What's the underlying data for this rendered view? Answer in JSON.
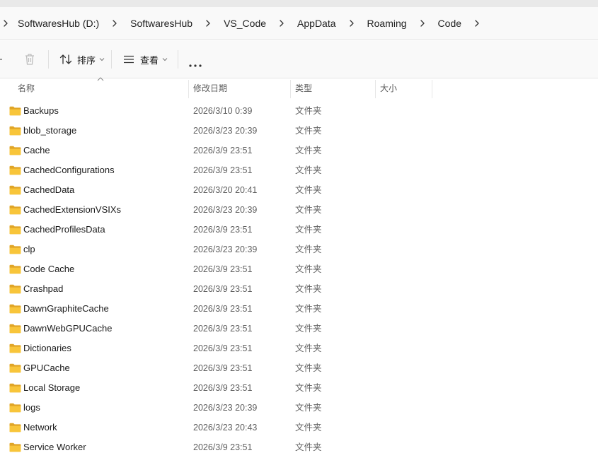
{
  "breadcrumb": [
    "SoftwaresHub (D:)",
    "SoftwaresHub",
    "VS_Code",
    "AppData",
    "Roaming",
    "Code"
  ],
  "toolbar": {
    "sort_label": "排序",
    "view_label": "查看",
    "more_label": "···"
  },
  "columns": {
    "name": "名称",
    "date": "修改日期",
    "type": "类型",
    "size": "大小"
  },
  "files": [
    {
      "name": "Backups",
      "date": "2026/3/10 0:39",
      "type": "文件夹",
      "size": ""
    },
    {
      "name": "blob_storage",
      "date": "2026/3/23 20:39",
      "type": "文件夹",
      "size": ""
    },
    {
      "name": "Cache",
      "date": "2026/3/9 23:51",
      "type": "文件夹",
      "size": ""
    },
    {
      "name": "CachedConfigurations",
      "date": "2026/3/9 23:51",
      "type": "文件夹",
      "size": ""
    },
    {
      "name": "CachedData",
      "date": "2026/3/20 20:41",
      "type": "文件夹",
      "size": ""
    },
    {
      "name": "CachedExtensionVSIXs",
      "date": "2026/3/23 20:39",
      "type": "文件夹",
      "size": ""
    },
    {
      "name": "CachedProfilesData",
      "date": "2026/3/9 23:51",
      "type": "文件夹",
      "size": ""
    },
    {
      "name": "clp",
      "date": "2026/3/23 20:39",
      "type": "文件夹",
      "size": ""
    },
    {
      "name": "Code Cache",
      "date": "2026/3/9 23:51",
      "type": "文件夹",
      "size": ""
    },
    {
      "name": "Crashpad",
      "date": "2026/3/9 23:51",
      "type": "文件夹",
      "size": ""
    },
    {
      "name": "DawnGraphiteCache",
      "date": "2026/3/9 23:51",
      "type": "文件夹",
      "size": ""
    },
    {
      "name": "DawnWebGPUCache",
      "date": "2026/3/9 23:51",
      "type": "文件夹",
      "size": ""
    },
    {
      "name": "Dictionaries",
      "date": "2026/3/9 23:51",
      "type": "文件夹",
      "size": ""
    },
    {
      "name": "GPUCache",
      "date": "2026/3/9 23:51",
      "type": "文件夹",
      "size": ""
    },
    {
      "name": "Local Storage",
      "date": "2026/3/9 23:51",
      "type": "文件夹",
      "size": ""
    },
    {
      "name": "logs",
      "date": "2026/3/23 20:39",
      "type": "文件夹",
      "size": ""
    },
    {
      "name": "Network",
      "date": "2026/3/23 20:43",
      "type": "文件夹",
      "size": ""
    },
    {
      "name": "Service Worker",
      "date": "2026/3/9 23:51",
      "type": "文件夹",
      "size": ""
    }
  ],
  "icons": {
    "folder": "folder-icon",
    "chevron": "chevron-right-icon",
    "trash": "trash-icon",
    "sort": "sort-icon",
    "view": "view-icon",
    "more": "more-icon"
  },
  "colors": {
    "folder_yellow": "#f8c53a",
    "folder_dark": "#e0a526",
    "muted_text": "#5f5f5f"
  }
}
